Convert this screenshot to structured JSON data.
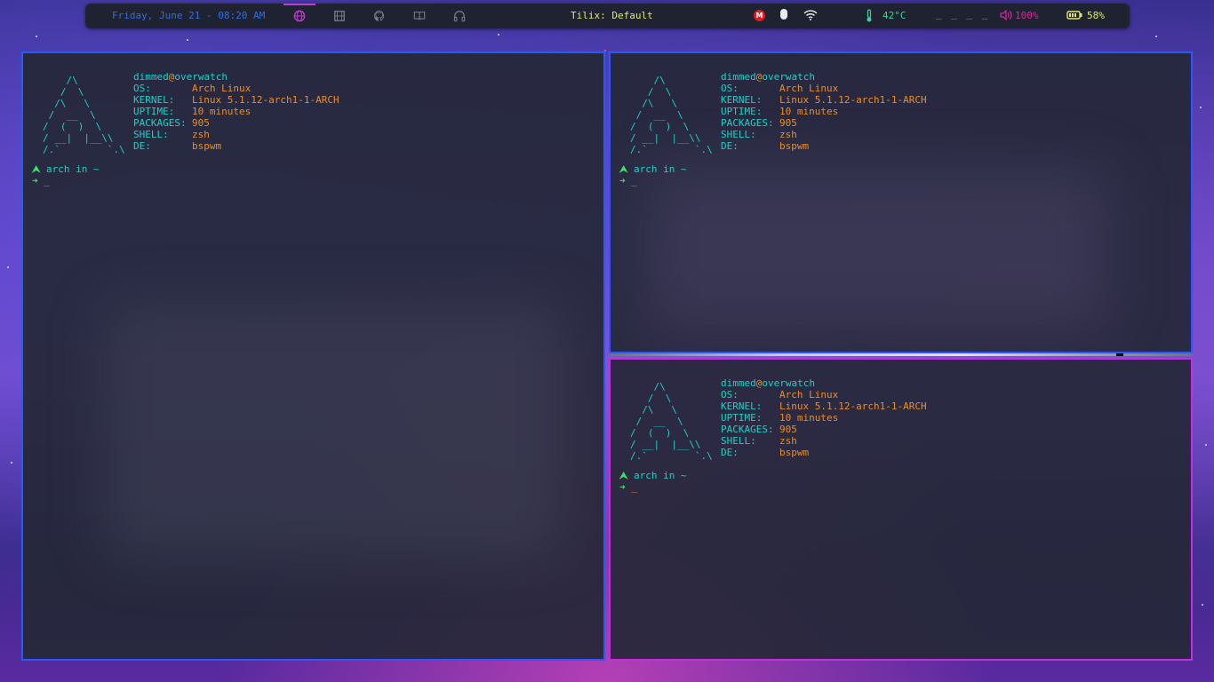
{
  "topbar": {
    "datetime": "Friday, June 21  - 08:20 AM",
    "workspaces": [
      {
        "icon": "globe-icon",
        "active": true
      },
      {
        "icon": "film-icon",
        "active": false
      },
      {
        "icon": "github-icon",
        "active": false
      },
      {
        "icon": "book-icon",
        "active": false
      },
      {
        "icon": "headphones-icon",
        "active": false
      }
    ],
    "window_title": "Tilix: Default",
    "mega_label": "M",
    "temperature": "42°C",
    "dashes": "_ _ _ _",
    "volume": "100%",
    "battery": "58%"
  },
  "terminal": {
    "logo": "    /\\\n   /  \\\n  /\\   \\\n /  __  \\\n/  (  )  \\\n/ __|  |__\\\\\n/.`        `.\\",
    "user": "dimmed",
    "at": "@",
    "host": "overwatch",
    "fields": [
      {
        "key": "OS:",
        "value": "Arch Linux"
      },
      {
        "key": "KERNEL:",
        "value": "Linux 5.1.12-arch1-1-ARCH"
      },
      {
        "key": "UPTIME:",
        "value": "10 minutes"
      },
      {
        "key": "PACKAGES:",
        "value": "905"
      },
      {
        "key": "SHELL:",
        "value": "zsh"
      },
      {
        "key": "DE:",
        "value": "bspwm"
      }
    ],
    "prompt_symbol": "⮝",
    "prompt_text": "arch in ~",
    "input_arrow": "➜",
    "cursor": "_"
  },
  "colors": {
    "border_unfocused": "#2b57ff",
    "border_focused": "#c52de1",
    "cyan": "#1fd0c6",
    "orange": "#e98e27",
    "green": "#3fe06a"
  }
}
